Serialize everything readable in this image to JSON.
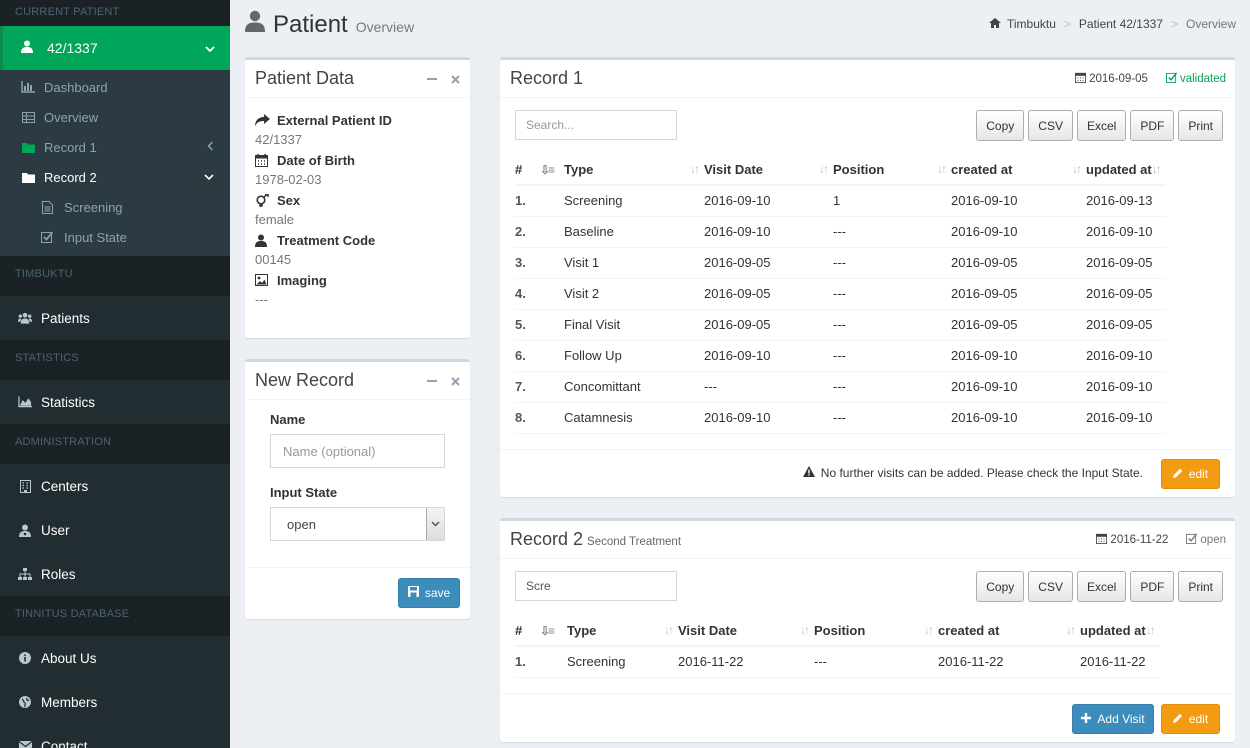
{
  "sidebar": {
    "current_patient_header": "CURRENT PATIENT",
    "patient_label": "42/1337",
    "tree": {
      "dashboard": "Dashboard",
      "overview": "Overview",
      "record1": "Record 1",
      "record2": "Record 2",
      "screening": "Screening",
      "input_state": "Input State"
    },
    "timbuktu_header": "TIMBUKTU",
    "patients": "Patients",
    "statistics_header": "STATISTICS",
    "statistics": "Statistics",
    "administration_header": "ADMINISTRATION",
    "centers": "Centers",
    "user": "User",
    "roles": "Roles",
    "tinnitus_header": "TINNITUS DATABASE",
    "about_us": "About Us",
    "members": "Members",
    "contact": "Contact"
  },
  "header": {
    "title": "Patient",
    "subtitle": "Overview",
    "breadcrumb": [
      "Timbuktu",
      "Patient 42/1337",
      "Overview"
    ]
  },
  "patient_data": {
    "title": "Patient Data",
    "fields": [
      {
        "label": "External Patient ID",
        "value": "42/1337",
        "icon": "share-icon"
      },
      {
        "label": "Date of Birth",
        "value": "1978-02-03",
        "icon": "calendar-icon"
      },
      {
        "label": "Sex",
        "value": "female",
        "icon": "gender-icon"
      },
      {
        "label": "Treatment Code",
        "value": "00145",
        "icon": "user-icon"
      },
      {
        "label": "Imaging",
        "value": "---",
        "icon": "image-icon"
      }
    ]
  },
  "new_record": {
    "title": "New Record",
    "name_label": "Name",
    "name_placeholder": "Name (optional)",
    "input_state_label": "Input State",
    "input_state_value": "open",
    "save_label": "save"
  },
  "record1": {
    "title": "Record 1",
    "date": "2016-09-05",
    "status": "validated",
    "search_placeholder": "Search...",
    "buttons": [
      "Copy",
      "CSV",
      "Excel",
      "PDF",
      "Print"
    ],
    "columns": [
      "#",
      "Type",
      "Visit Date",
      "Position",
      "created at",
      "updated at"
    ],
    "rows": [
      [
        "1.",
        "Screening",
        "2016-09-10",
        "1",
        "2016-09-10",
        "2016-09-13"
      ],
      [
        "2.",
        "Baseline",
        "2016-09-10",
        "---",
        "2016-09-10",
        "2016-09-10"
      ],
      [
        "3.",
        "Visit 1",
        "2016-09-05",
        "---",
        "2016-09-05",
        "2016-09-05"
      ],
      [
        "4.",
        "Visit 2",
        "2016-09-05",
        "---",
        "2016-09-05",
        "2016-09-05"
      ],
      [
        "5.",
        "Final Visit",
        "2016-09-05",
        "---",
        "2016-09-05",
        "2016-09-05"
      ],
      [
        "6.",
        "Follow Up",
        "2016-09-10",
        "---",
        "2016-09-10",
        "2016-09-10"
      ],
      [
        "7.",
        "Concomittant",
        "---",
        "---",
        "2016-09-10",
        "2016-09-10"
      ],
      [
        "8.",
        "Catamnesis",
        "2016-09-10",
        "---",
        "2016-09-10",
        "2016-09-10"
      ]
    ],
    "warning": "No further visits can be added. Please check the Input State.",
    "edit_label": "edit"
  },
  "record2": {
    "title": "Record 2",
    "subtitle": "Second Treatment",
    "date": "2016-11-22",
    "status": "open",
    "search_value": "Scre",
    "buttons": [
      "Copy",
      "CSV",
      "Excel",
      "PDF",
      "Print"
    ],
    "columns": [
      "#",
      "Type",
      "Visit Date",
      "Position",
      "created at",
      "updated at"
    ],
    "rows": [
      [
        "1.",
        "Screening",
        "2016-11-22",
        "---",
        "2016-11-22",
        "2016-11-22"
      ]
    ],
    "add_visit_label": "Add Visit",
    "edit_label": "edit"
  },
  "colors": {
    "sidebar_bg": "#222d32",
    "active_green": "#00a65a",
    "primary_blue": "#3c8dbc",
    "warning_orange": "#f39c12"
  }
}
